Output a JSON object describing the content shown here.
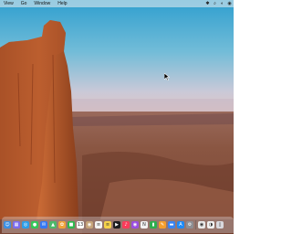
{
  "menubar": {
    "apple_icon": "apple-icon",
    "menus": [
      "View",
      "Go",
      "Window",
      "Help"
    ],
    "status_icons": [
      "bluetooth-icon",
      "spotlight-search-icon",
      "control-center-icon",
      "siri-icon"
    ]
  },
  "dock": {
    "apps": [
      {
        "name": "finder-icon",
        "color": "#3b8fe3",
        "glyph": "☺"
      },
      {
        "name": "launchpad-icon",
        "color": "#7b6cf0",
        "glyph": "▦"
      },
      {
        "name": "safari-icon",
        "color": "#2d9ee8",
        "glyph": "◎"
      },
      {
        "name": "messages-icon",
        "color": "#34c759",
        "glyph": "●"
      },
      {
        "name": "mail-icon",
        "color": "#3478f6",
        "glyph": "✉"
      },
      {
        "name": "maps-icon",
        "color": "#4cb86a",
        "glyph": "▲"
      },
      {
        "name": "photos-icon",
        "color": "#f2a33b",
        "glyph": "✿"
      },
      {
        "name": "facetime-icon",
        "color": "#2fb84f",
        "glyph": "■"
      },
      {
        "name": "calendar-icon",
        "color": "#ffffff",
        "glyph": "13"
      },
      {
        "name": "contacts-icon",
        "color": "#c6a47a",
        "glyph": "◉"
      },
      {
        "name": "reminders-icon",
        "color": "#f4f4f4",
        "glyph": "≡"
      },
      {
        "name": "notes-icon",
        "color": "#f7d34a",
        "glyph": "≡"
      },
      {
        "name": "tv-icon",
        "color": "#1c1c1e",
        "glyph": "▶"
      },
      {
        "name": "music-icon",
        "color": "#fa3c5a",
        "glyph": "♪"
      },
      {
        "name": "podcasts-icon",
        "color": "#9b4ee0",
        "glyph": "◉"
      },
      {
        "name": "news-icon",
        "color": "#f2f2f2",
        "glyph": "N"
      },
      {
        "name": "numbers-icon",
        "color": "#2fae4e",
        "glyph": "▮"
      },
      {
        "name": "pages-icon",
        "color": "#f59e2b",
        "glyph": "✎"
      },
      {
        "name": "keynote-icon",
        "color": "#3a84f0",
        "glyph": "▬"
      },
      {
        "name": "app-store-icon",
        "color": "#1e8af5",
        "glyph": "A"
      },
      {
        "name": "system-settings-icon",
        "color": "#8e8e93",
        "glyph": "⚙"
      },
      {
        "name": "chrome-icon",
        "color": "#e9e9e9",
        "glyph": "◉"
      },
      {
        "name": "other-app-icon",
        "color": "#f0f0f0",
        "glyph": "◑"
      },
      {
        "name": "trash-icon",
        "color": "#d9d9de",
        "glyph": "▯"
      }
    ]
  }
}
